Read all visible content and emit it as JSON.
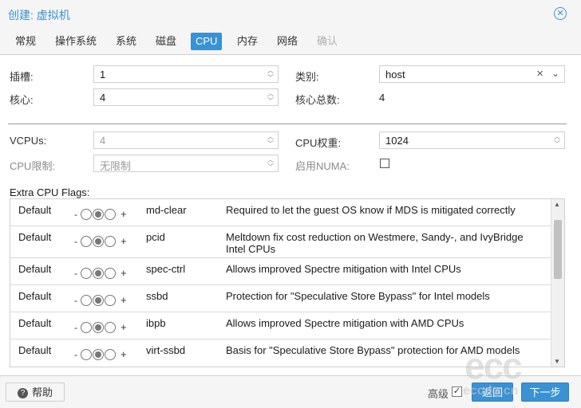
{
  "window": {
    "title": "创建: 虚拟机"
  },
  "tabs": [
    {
      "label": "常规"
    },
    {
      "label": "操作系统"
    },
    {
      "label": "系统"
    },
    {
      "label": "磁盘"
    },
    {
      "label": "CPU"
    },
    {
      "label": "内存"
    },
    {
      "label": "网络"
    },
    {
      "label": "确认"
    }
  ],
  "cpu": {
    "sockets": {
      "label": "插槽:",
      "value": "1"
    },
    "cores": {
      "label": "核心:",
      "value": "4"
    },
    "type": {
      "label": "类别:",
      "value": "host"
    },
    "total_cores": {
      "label": "核心总数:",
      "value": "4"
    },
    "vcpus": {
      "label": "VCPUs:",
      "value": "4"
    },
    "cpu_limit": {
      "label": "CPU限制:",
      "value": "无限制"
    },
    "cpu_weight": {
      "label": "CPU权重:",
      "value": "1024"
    },
    "numa": {
      "label": "启用NUMA:"
    }
  },
  "flags": {
    "title": "Extra CPU Flags:",
    "minus": "-",
    "plus": "+",
    "rows": [
      {
        "state": "Default",
        "name": "md-clear",
        "desc": "Required to let the guest OS know if MDS is mitigated correctly"
      },
      {
        "state": "Default",
        "name": "pcid",
        "desc": "Meltdown fix cost reduction on Westmere, Sandy-, and IvyBridge Intel CPUs"
      },
      {
        "state": "Default",
        "name": "spec-ctrl",
        "desc": "Allows improved Spectre mitigation with Intel CPUs"
      },
      {
        "state": "Default",
        "name": "ssbd",
        "desc": "Protection for \"Speculative Store Bypass\" for Intel models"
      },
      {
        "state": "Default",
        "name": "ibpb",
        "desc": "Allows improved Spectre mitigation with AMD CPUs"
      },
      {
        "state": "Default",
        "name": "virt-ssbd",
        "desc": "Basis for \"Speculative Store Bypass\" protection for AMD models"
      }
    ]
  },
  "footer": {
    "help": "帮助",
    "advanced": "高级",
    "back": "返回",
    "next": "下一步"
  },
  "watermark": {
    "logo": "ecc",
    "site": "eccdo.cn"
  },
  "colors": {
    "accent": "#3892d4"
  }
}
